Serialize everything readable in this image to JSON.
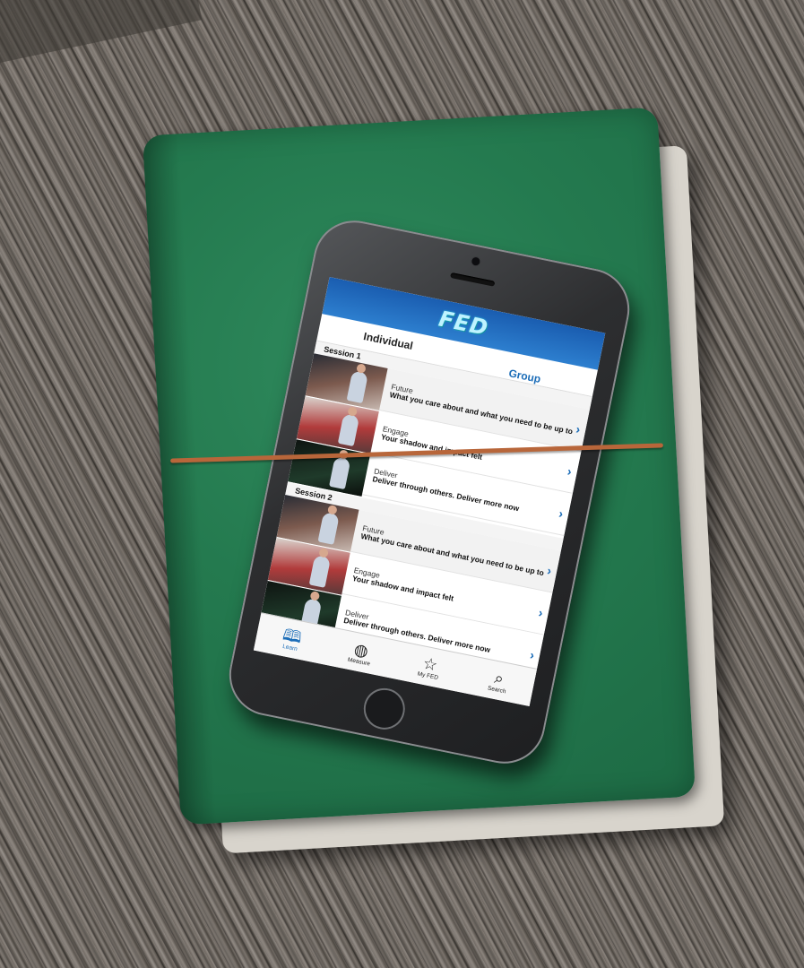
{
  "app": {
    "logo_text": "FED"
  },
  "tabs": {
    "individual": "Individual",
    "group": "Group"
  },
  "sessions": [
    {
      "title": "Session 1",
      "lessons": [
        {
          "title": "Future",
          "desc": "What you care about and what you need to be up to"
        },
        {
          "title": "Engage",
          "desc": "Your shadow and impact felt"
        },
        {
          "title": "Deliver",
          "desc": "Deliver through others. Deliver more now"
        }
      ]
    },
    {
      "title": "Session 2",
      "lessons": [
        {
          "title": "Future",
          "desc": "What you care about and what you need to be up to"
        },
        {
          "title": "Engage",
          "desc": "Your shadow and impact felt"
        },
        {
          "title": "Deliver",
          "desc": "Deliver through others. Deliver more now"
        }
      ]
    }
  ],
  "tabbar": {
    "items": [
      {
        "label": "Learn",
        "icon": "book-icon"
      },
      {
        "label": "Measure",
        "icon": "globe-icon"
      },
      {
        "label": "My FED",
        "icon": "star-icon"
      },
      {
        "label": "Search",
        "icon": "magnifier-icon"
      }
    ]
  },
  "colors": {
    "header_blue": "#1a5db0",
    "accent_blue": "#1c6db8",
    "notebook_green": "#247a4f",
    "elastic_band": "#b8663a"
  }
}
